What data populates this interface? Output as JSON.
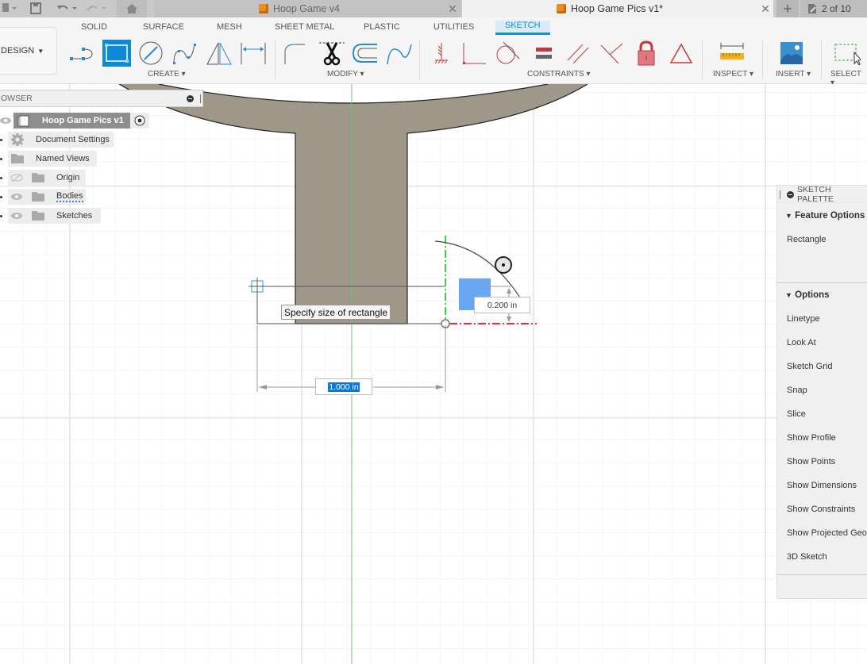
{
  "window": {
    "tabs": [
      {
        "label": "Hoop Game v4",
        "active": false
      },
      {
        "label": "Hoop Game Pics v1*",
        "active": true
      }
    ],
    "jobs_status": "2 of 10"
  },
  "ribbon": {
    "workspace": "DESIGN",
    "tabs": [
      "SOLID",
      "SURFACE",
      "MESH",
      "SHEET METAL",
      "PLASTIC",
      "UTILITIES",
      "SKETCH"
    ],
    "active_tab": "SKETCH",
    "groups": {
      "create": "CREATE",
      "modify": "MODIFY",
      "constraints": "CONSTRAINTS",
      "inspect": "INSPECT",
      "insert": "INSERT",
      "select": "SELECT"
    },
    "accent": "#0c8ad6"
  },
  "browser": {
    "title": "OWSER",
    "root": "Hoop Game Pics v1",
    "items": [
      {
        "label": "Document Settings",
        "icon": "gear-icon"
      },
      {
        "label": "Named Views",
        "icon": "folder-icon"
      },
      {
        "label": "Origin",
        "icon": "folder-icon",
        "visibility": "hidden"
      },
      {
        "label": "Bodies",
        "icon": "folder-icon",
        "visibility": "visible"
      },
      {
        "label": "Sketches",
        "icon": "folder-icon",
        "visibility": "visible"
      }
    ]
  },
  "canvas": {
    "tooltip": "Specify size of rectangle",
    "width_dimension": "1.000 in",
    "height_dimension": "0.200 in"
  },
  "palette": {
    "title": "SKETCH PALETTE",
    "feature_options_label": "Feature Options",
    "feature_tool": "Rectangle",
    "options_label": "Options",
    "options": [
      "Linetype",
      "Look At",
      "Sketch Grid",
      "Snap",
      "Slice",
      "Show Profile",
      "Show Points",
      "Show Dimensions",
      "Show Constraints",
      "Show Projected Geometries",
      "3D Sketch"
    ]
  }
}
